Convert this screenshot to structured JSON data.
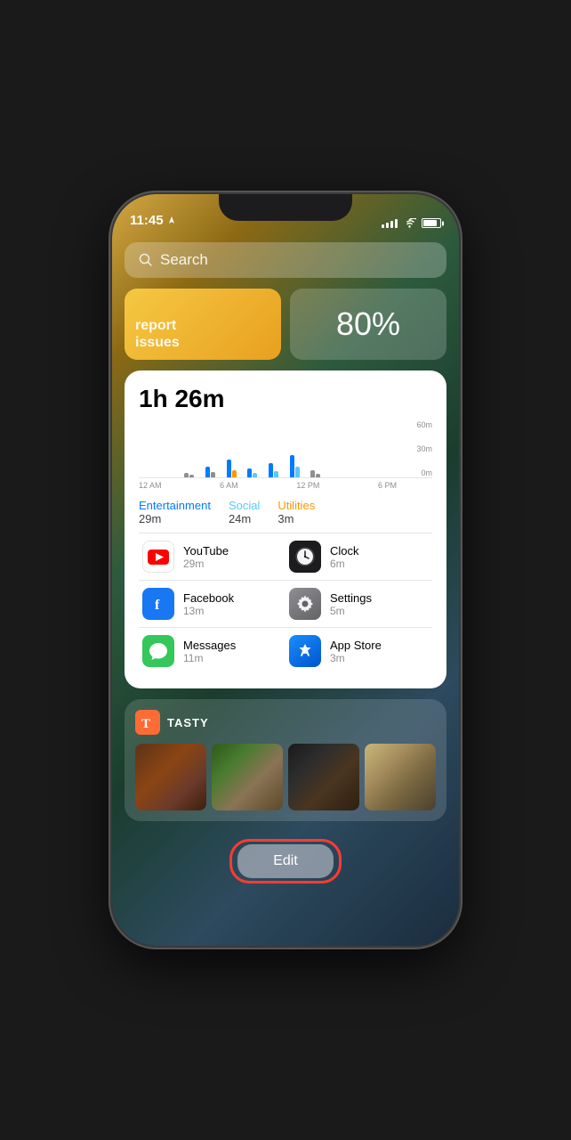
{
  "statusBar": {
    "time": "11:45",
    "locationIcon": "▶",
    "batteryPercent": 85
  },
  "searchBar": {
    "placeholder": "Search",
    "searchIcon": "🔍"
  },
  "widgetIssues": {
    "line1": "report",
    "line2": "issues"
  },
  "widgetBattery": {
    "value": "80%"
  },
  "screenTime": {
    "total": "1h 26m",
    "chartYLabels": [
      "60m",
      "30m",
      "0m"
    ],
    "chartXLabels": [
      "12 AM",
      "6 AM",
      "12 PM",
      "6 PM"
    ],
    "categories": [
      {
        "name": "Entertainment",
        "time": "29m",
        "color": "#007AFF"
      },
      {
        "name": "Social",
        "time": "24m",
        "color": "#5AC8FA"
      },
      {
        "name": "Utilities",
        "time": "3m",
        "color": "#FF9500"
      }
    ],
    "apps": [
      {
        "name": "YouTube",
        "time": "29m",
        "iconType": "youtube"
      },
      {
        "name": "Clock",
        "time": "6m",
        "iconType": "clock"
      },
      {
        "name": "Facebook",
        "time": "13m",
        "iconType": "facebook"
      },
      {
        "name": "Settings",
        "time": "5m",
        "iconType": "settings"
      },
      {
        "name": "Messages",
        "time": "11m",
        "iconType": "messages"
      },
      {
        "name": "App Store",
        "time": "3m",
        "iconType": "appstore"
      }
    ]
  },
  "tastyWidget": {
    "brandName": "TASTY",
    "logoText": "T",
    "images": [
      "food1",
      "food2",
      "food3",
      "food4"
    ]
  },
  "editButton": {
    "label": "Edit"
  },
  "chart": {
    "bars": [
      {
        "heights": [
          0,
          0
        ],
        "colors": [
          "#007AFF",
          "#8e8e93"
        ]
      },
      {
        "heights": [
          0,
          0
        ],
        "colors": [
          "#007AFF",
          "#8e8e93"
        ]
      },
      {
        "heights": [
          5,
          3
        ],
        "colors": [
          "#8e8e93",
          "#8e8e93"
        ]
      },
      {
        "heights": [
          12,
          8
        ],
        "colors": [
          "#007AFF",
          "#8e8e93"
        ]
      },
      {
        "heights": [
          18,
          10
        ],
        "colors": [
          "#007AFF",
          "#FF9500"
        ]
      },
      {
        "heights": [
          8,
          5
        ],
        "colors": [
          "#007AFF",
          "#5AC8FA"
        ]
      },
      {
        "heights": [
          14,
          9
        ],
        "colors": [
          "#007AFF",
          "#5AC8FA"
        ]
      },
      {
        "heights": [
          22,
          12
        ],
        "colors": [
          "#007AFF",
          "#5AC8FA"
        ]
      },
      {
        "heights": [
          6,
          3
        ],
        "colors": [
          "#8e8e93",
          "#8e8e93"
        ]
      },
      {
        "heights": [
          0,
          0
        ],
        "colors": [
          "#007AFF",
          "#8e8e93"
        ]
      },
      {
        "heights": [
          0,
          0
        ],
        "colors": [
          "#007AFF",
          "#8e8e93"
        ]
      },
      {
        "heights": [
          0,
          0
        ],
        "colors": [
          "#007AFF",
          "#8e8e93"
        ]
      }
    ]
  }
}
